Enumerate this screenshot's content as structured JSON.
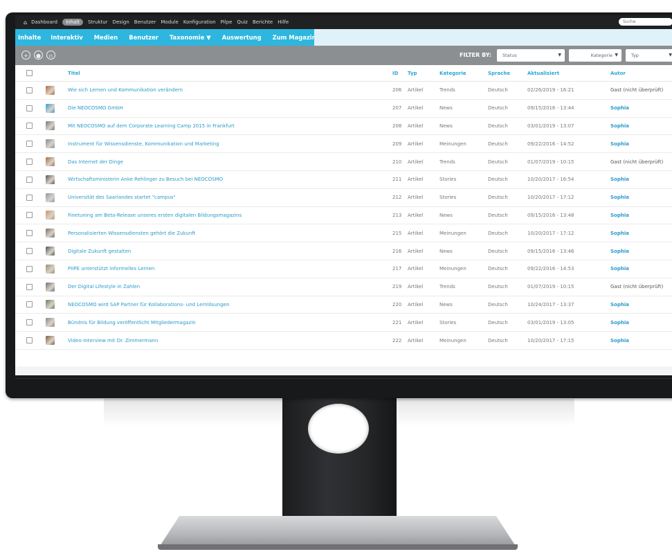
{
  "topnav": {
    "items": [
      "Dashboard",
      "Inhalt",
      "Struktur",
      "Design",
      "Benutzer",
      "Module",
      "Konfiguration",
      "Pilpe",
      "Quiz",
      "Berichte",
      "Hilfe"
    ],
    "active": "Inhalt",
    "search_placeholder": "Suche"
  },
  "subnav": {
    "items": [
      "Inhalte",
      "Interaktiv",
      "Medien",
      "Benutzer",
      "Taxonomie ▼",
      "Auswertung",
      "Zum Magazin"
    ]
  },
  "filterbar": {
    "label": "FILTER BY:",
    "status": "Status",
    "kategorie": "Kategorie",
    "typ": "Typ"
  },
  "table": {
    "headers": {
      "titel": "Titel",
      "id": "ID",
      "typ": "Typ",
      "kategorie": "Kategorie",
      "sprache": "Sprache",
      "aktualisiert": "Aktualisiert",
      "autor": "Autor"
    },
    "rows": [
      {
        "title": "Wie sich Lernen und Kommunikation verändern",
        "id": "206",
        "typ": "Artikel",
        "kategorie": "Trends",
        "sprache": "Deutsch",
        "updated": "02/26/2019 - 16:21",
        "author": "Gast (nicht überprüft)",
        "guest": true,
        "thumb": "#b0683a"
      },
      {
        "title": "Die NEOCOSMO GmbH",
        "id": "207",
        "typ": "Artikel",
        "kategorie": "News",
        "sprache": "Deutsch",
        "updated": "09/15/2016 - 13:44",
        "author": "Sophia",
        "guest": false,
        "thumb": "#2d9fd8"
      },
      {
        "title": "Mit NEOCOSMO auf dem Corporate Learning Camp 2015 in Frankfurt",
        "id": "208",
        "typ": "Artikel",
        "kategorie": "News",
        "sprache": "Deutsch",
        "updated": "03/01/2019 - 13:07",
        "author": "Sophia",
        "guest": false,
        "thumb": "#6e7c78"
      },
      {
        "title": "Instrument für Wissensdienste, Kommunikation und Marketing",
        "id": "209",
        "typ": "Artikel",
        "kategorie": "Meinungen",
        "sprache": "Deutsch",
        "updated": "09/22/2016 - 14:52",
        "author": "Sophia",
        "guest": false,
        "thumb": "#7b8e98"
      },
      {
        "title": "Das Internet der Dinge",
        "id": "210",
        "typ": "Artikel",
        "kategorie": "Trends",
        "sprache": "Deutsch",
        "updated": "01/07/2019 - 10:15",
        "author": "Gast (nicht überprüft)",
        "guest": true,
        "thumb": "#a56a42"
      },
      {
        "title": "Wirtschaftsministerin Anke Rehlinger zu Besuch bei NEOCOSMO",
        "id": "211",
        "typ": "Artikel",
        "kategorie": "Stories",
        "sprache": "Deutsch",
        "updated": "10/20/2017 - 16:54",
        "author": "Sophia",
        "guest": false,
        "thumb": "#5b5450"
      },
      {
        "title": "Universität des Saarlandes startet \"campus\"",
        "id": "212",
        "typ": "Artikel",
        "kategorie": "Stories",
        "sprache": "Deutsch",
        "updated": "10/20/2017 - 17:12",
        "author": "Sophia",
        "guest": false,
        "thumb": "#8b97a6"
      },
      {
        "title": "Finetuning am Beta-Release unseres ersten digitalen Bildungsmagazins",
        "id": "213",
        "typ": "Artikel",
        "kategorie": "News",
        "sprache": "Deutsch",
        "updated": "09/15/2016 - 13:48",
        "author": "Sophia",
        "guest": false,
        "thumb": "#c9956c"
      },
      {
        "title": "Personalisierten Wissensdiensten gehört die Zukunft",
        "id": "215",
        "typ": "Artikel",
        "kategorie": "Meinungen",
        "sprache": "Deutsch",
        "updated": "10/20/2017 - 17:12",
        "author": "Sophia",
        "guest": false,
        "thumb": "#7a6a66"
      },
      {
        "title": "Digitale Zukunft gestalten",
        "id": "216",
        "typ": "Artikel",
        "kategorie": "News",
        "sprache": "Deutsch",
        "updated": "09/15/2016 - 13:46",
        "author": "Sophia",
        "guest": false,
        "thumb": "#4d5458"
      },
      {
        "title": "PIIPE unterstützt informelles Lernen",
        "id": "217",
        "typ": "Artikel",
        "kategorie": "Meinungen",
        "sprache": "Deutsch",
        "updated": "09/22/2016 - 14:53",
        "author": "Sophia",
        "guest": false,
        "thumb": "#9a8a72"
      },
      {
        "title": "Der Digital Lifestyle in Zahlen",
        "id": "219",
        "typ": "Artikel",
        "kategorie": "Trends",
        "sprache": "Deutsch",
        "updated": "01/07/2019 - 10:15",
        "author": "Gast (nicht überprüft)",
        "guest": true,
        "thumb": "#6b6f74"
      },
      {
        "title": "NEOCOSMO wird SAP Partner für Kollaborations- und Lernlösungen",
        "id": "220",
        "typ": "Artikel",
        "kategorie": "News",
        "sprache": "Deutsch",
        "updated": "10/24/2017 - 13:37",
        "author": "Sophia",
        "guest": false,
        "thumb": "#5e7f5c"
      },
      {
        "title": "Bündnis für Bildung veröffentlicht Mitgliedermagazin",
        "id": "221",
        "typ": "Artikel",
        "kategorie": "Stories",
        "sprache": "Deutsch",
        "updated": "03/01/2019 - 13:05",
        "author": "Sophia",
        "guest": false,
        "thumb": "#8e8680"
      },
      {
        "title": "Video-Interview mit Dr. Zimmermann",
        "id": "222",
        "typ": "Artikel",
        "kategorie": "Meinungen",
        "sprache": "Deutsch",
        "updated": "10/20/2017 - 17:15",
        "author": "Sophia",
        "guest": false,
        "thumb": "#7c5a3a"
      }
    ]
  },
  "colors": {
    "accent": "#2eb6de",
    "topbar": "#1f2123",
    "filterbar": "#8c8f92",
    "link": "#2a9bc9"
  }
}
